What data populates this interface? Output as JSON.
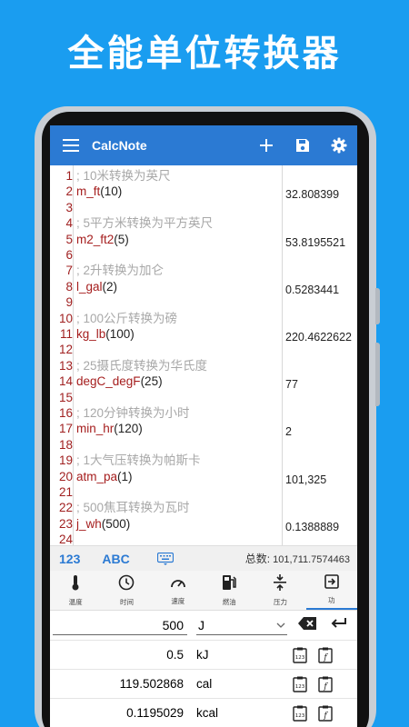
{
  "headline": "全能单位转换器",
  "app": {
    "title": "CalcNote"
  },
  "editor": {
    "lines": [
      {
        "n": "1",
        "code": "; 10米转换为英尺",
        "kind": "comment",
        "result": ""
      },
      {
        "n": "2",
        "fn": "m_ft",
        "args": "(10)",
        "kind": "expr",
        "result": "32.808399"
      },
      {
        "n": "3",
        "code": "",
        "kind": "blank",
        "result": ""
      },
      {
        "n": "4",
        "code": "; 5平方米转换为平方英尺",
        "kind": "comment",
        "result": ""
      },
      {
        "n": "5",
        "fn": "m2_ft2",
        "args": "(5)",
        "kind": "expr",
        "result": "53.8195521"
      },
      {
        "n": "6",
        "code": "",
        "kind": "blank",
        "result": ""
      },
      {
        "n": "7",
        "code": "; 2升转换为加仑",
        "kind": "comment",
        "result": ""
      },
      {
        "n": "8",
        "fn": "l_gal",
        "args": "(2)",
        "kind": "expr",
        "result": "0.5283441"
      },
      {
        "n": "9",
        "code": "",
        "kind": "blank",
        "result": ""
      },
      {
        "n": "10",
        "code": "; 100公斤转换为磅",
        "kind": "comment",
        "result": ""
      },
      {
        "n": "11",
        "fn": "kg_lb",
        "args": "(100)",
        "kind": "expr",
        "result": "220.4622622"
      },
      {
        "n": "12",
        "code": "",
        "kind": "blank",
        "result": ""
      },
      {
        "n": "13",
        "code": "; 25摄氏度转换为华氏度",
        "kind": "comment",
        "result": ""
      },
      {
        "n": "14",
        "fn": "degC_degF",
        "args": "(25)",
        "kind": "expr",
        "result": "77"
      },
      {
        "n": "15",
        "code": "",
        "kind": "blank",
        "result": ""
      },
      {
        "n": "16",
        "code": "; 120分钟转换为小时",
        "kind": "comment",
        "result": ""
      },
      {
        "n": "17",
        "fn": "min_hr",
        "args": "(120)",
        "kind": "expr",
        "result": "2"
      },
      {
        "n": "18",
        "code": "",
        "kind": "blank",
        "result": ""
      },
      {
        "n": "19",
        "code": "; 1大气压转换为帕斯卡",
        "kind": "comment",
        "result": ""
      },
      {
        "n": "20",
        "fn": "atm_pa",
        "args": "(1)",
        "kind": "expr",
        "result": "101,325"
      },
      {
        "n": "21",
        "code": "",
        "kind": "blank",
        "result": ""
      },
      {
        "n": "22",
        "code": "; 500焦耳转换为瓦时",
        "kind": "comment",
        "result": ""
      },
      {
        "n": "23",
        "fn": "j_wh",
        "args": "(500)",
        "kind": "expr",
        "result": "0.1388889"
      },
      {
        "n": "24",
        "code": "",
        "kind": "blank",
        "result": ""
      }
    ]
  },
  "keyboard_bar": {
    "mode_123": "123",
    "mode_abc": "ABC",
    "total_label": "总数:",
    "total_value": "101,711.7574463"
  },
  "categories": [
    {
      "label": "温度",
      "icon": "thermometer-icon"
    },
    {
      "label": "时间",
      "icon": "clock-icon"
    },
    {
      "label": "速度",
      "icon": "speedometer-icon"
    },
    {
      "label": "燃油",
      "icon": "fuel-icon"
    },
    {
      "label": "压力",
      "icon": "pressure-icon"
    },
    {
      "label": "功",
      "icon": "work-icon",
      "active": true
    }
  ],
  "converter": {
    "input_value": "500",
    "input_unit": "J",
    "outputs": [
      {
        "value": "0.5",
        "unit": "kJ"
      },
      {
        "value": "119.502868",
        "unit": "cal"
      },
      {
        "value": "0.1195029",
        "unit": "kcal"
      }
    ]
  },
  "colors": {
    "background": "#1a9df0",
    "appbar": "#2b7ad3",
    "function": "#a51d1d",
    "comment": "#a8a8a8"
  }
}
